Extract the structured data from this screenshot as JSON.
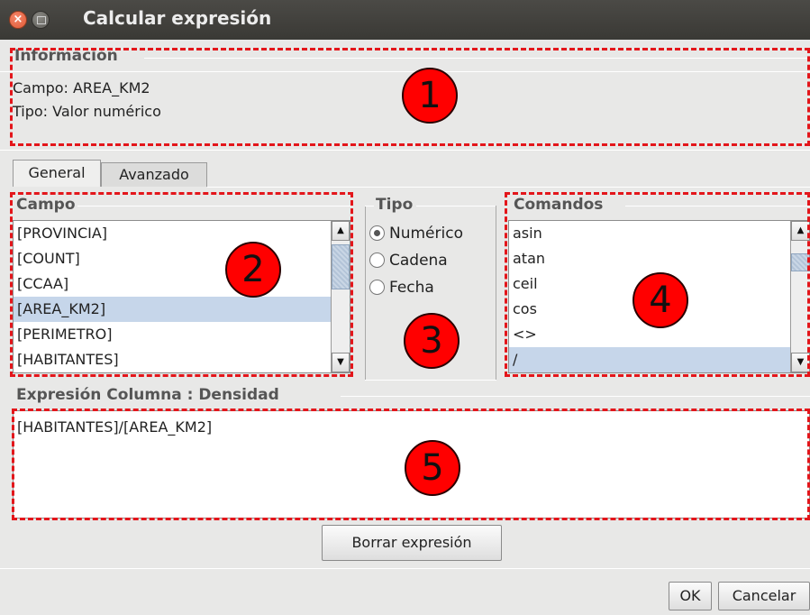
{
  "window": {
    "title": "Calcular expresión",
    "close_glyph": "×"
  },
  "informacion": {
    "legend": "Información",
    "campo_line": "Campo:  AREA_KM2",
    "tipo_line": "Tipo: Valor numérico"
  },
  "tabs": [
    {
      "label": "General",
      "active": true
    },
    {
      "label": "Avanzado",
      "active": false
    }
  ],
  "campo": {
    "legend": "Campo",
    "items": [
      "[PROVINCIA]",
      "[COUNT]",
      "[CCAA]",
      "[AREA_KM2]",
      "[PERIMETRO]",
      "[HABITANTES]"
    ],
    "selected": "[AREA_KM2]"
  },
  "tipo": {
    "legend": "Tipo",
    "options": [
      "Numérico",
      "Cadena",
      "Fecha"
    ],
    "selected": "Numérico"
  },
  "comandos": {
    "legend": "Comandos",
    "items": [
      "asin",
      "atan",
      "ceil",
      "cos",
      "<>",
      "/"
    ],
    "selected": "/"
  },
  "expresion": {
    "legend": "Expresión Columna : Densidad",
    "value": "[HABITANTES]/[AREA_KM2]"
  },
  "buttons": {
    "borrar": "Borrar expresión",
    "ok": "OK",
    "cancelar": "Cancelar"
  },
  "callouts": [
    "1",
    "2",
    "3",
    "4",
    "5"
  ],
  "scroll_arrows": {
    "up": "▲",
    "down": "▼"
  },
  "colors": {
    "annotation": "#e3161b",
    "callout": "#ff0000",
    "selection": "#c6d6ea"
  }
}
